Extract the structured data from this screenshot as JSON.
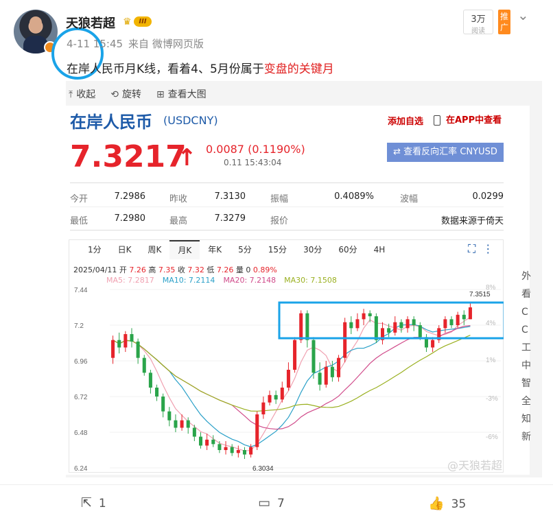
{
  "author": {
    "name": "天狼若超",
    "level_badge": "III",
    "crown_icon": "crown-icon"
  },
  "meta": {
    "date": "4-11 15:45",
    "source": "来自 微博网页版"
  },
  "views": {
    "count": "3万",
    "label": "阅读"
  },
  "promote": "推广",
  "post": {
    "text_pre": "在岸人民币月K线，看着4、5月份属于",
    "text_red": "变盘的关键月"
  },
  "toolbar": {
    "collapse": "收起",
    "rotate": "旋转",
    "view_large": "查看大图"
  },
  "quote": {
    "title": "在岸人民币",
    "code": "(USDCNY)",
    "add_fav": "添加自选",
    "in_app": "在APP中查看",
    "price": "7.3217",
    "change": "0.0087 (0.1190%)",
    "time": "0.11 15:43:04",
    "reverse_btn": "⇄ 查看反向汇率 CNYUSD",
    "stats_row1": [
      [
        "今开",
        "7.2986"
      ],
      [
        "昨收",
        "7.3130"
      ],
      [
        "振幅",
        "0.4089%"
      ],
      [
        "波幅",
        "0.0299"
      ]
    ],
    "stats_row2": [
      [
        "最低",
        "7.2980"
      ],
      [
        "最高",
        "7.3279"
      ],
      [
        "报价",
        ""
      ],
      [
        "",
        "数据来源于倚天"
      ]
    ]
  },
  "tabs": [
    "1分",
    "日K",
    "周K",
    "月K",
    "年K",
    "5分",
    "15分",
    "30分",
    "60分",
    "4H"
  ],
  "active_tab": "月K",
  "ohlc": {
    "date": "2025/04/11",
    "open_l": "开",
    "open": "7.26",
    "high_l": "高",
    "high": "7.35",
    "close_l": "收",
    "close": "7.32",
    "low_l": "低",
    "low": "7.26",
    "vol_l": "量",
    "vol": "0",
    "pct": "0.89%"
  },
  "ma": [
    {
      "label": "MA5: 7.2817",
      "color": "#f0a0b0"
    },
    {
      "label": "MA10: 7.2114",
      "color": "#2aa0c8"
    },
    {
      "label": "MA20: 7.2148",
      "color": "#d04a8a"
    },
    {
      "label": "MA30: 7.1508",
      "color": "#9ab020"
    }
  ],
  "chart_data": {
    "type": "candlestick",
    "y_ticks": [
      "7.44",
      "7.2",
      "6.96",
      "6.72",
      "6.48",
      "6.24"
    ],
    "ylim": [
      6.24,
      7.44
    ],
    "right_ticks": [
      "8%",
      "4%",
      "1%",
      "-3%",
      "-6%"
    ],
    "annotations": {
      "high": "7.3515",
      "low": "6.3034"
    },
    "candles": [
      [
        6.98,
        7.1,
        7.13,
        6.94
      ],
      [
        7.1,
        7.05,
        7.15,
        7.01
      ],
      [
        7.05,
        7.14,
        7.16,
        7.02
      ],
      [
        7.14,
        7.09,
        7.18,
        7.05
      ],
      [
        7.09,
        6.98,
        7.11,
        6.94
      ],
      [
        6.98,
        6.88,
        7.0,
        6.86
      ],
      [
        6.88,
        6.78,
        6.9,
        6.74
      ],
      [
        6.78,
        6.72,
        6.8,
        6.69
      ],
      [
        6.72,
        6.62,
        6.74,
        6.58
      ],
      [
        6.62,
        6.56,
        6.65,
        6.52
      ],
      [
        6.56,
        6.51,
        6.6,
        6.48
      ],
      [
        6.51,
        6.56,
        6.6,
        6.49
      ],
      [
        6.56,
        6.51,
        6.58,
        6.47
      ],
      [
        6.51,
        6.45,
        6.53,
        6.42
      ],
      [
        6.45,
        6.39,
        6.48,
        6.37
      ],
      [
        6.39,
        6.43,
        6.47,
        6.36
      ],
      [
        6.43,
        6.4,
        6.46,
        6.38
      ],
      [
        6.4,
        6.36,
        6.42,
        6.34
      ],
      [
        6.36,
        6.38,
        6.42,
        6.33
      ],
      [
        6.38,
        6.34,
        6.4,
        6.32
      ],
      [
        6.34,
        6.36,
        6.39,
        6.31
      ],
      [
        6.36,
        6.33,
        6.38,
        6.3
      ],
      [
        6.33,
        6.38,
        6.4,
        6.31
      ],
      [
        6.38,
        6.6,
        6.62,
        6.36
      ],
      [
        6.6,
        6.68,
        6.72,
        6.57
      ],
      [
        6.68,
        6.73,
        6.76,
        6.66
      ],
      [
        6.73,
        6.7,
        6.76,
        6.67
      ],
      [
        6.7,
        6.78,
        6.82,
        6.68
      ],
      [
        6.78,
        6.9,
        6.95,
        6.76
      ],
      [
        6.9,
        7.1,
        7.12,
        6.88
      ],
      [
        7.1,
        7.28,
        7.3,
        7.08
      ],
      [
        7.28,
        7.1,
        7.3,
        7.05
      ],
      [
        7.1,
        6.88,
        7.12,
        6.84
      ],
      [
        6.88,
        6.8,
        6.95,
        6.76
      ],
      [
        6.8,
        6.92,
        6.96,
        6.78
      ],
      [
        6.92,
        6.85,
        6.96,
        6.82
      ],
      [
        6.85,
        6.98,
        7.0,
        6.82
      ],
      [
        6.98,
        7.22,
        7.25,
        6.95
      ],
      [
        7.22,
        7.18,
        7.26,
        7.14
      ],
      [
        7.18,
        7.24,
        7.28,
        7.16
      ],
      [
        7.24,
        7.28,
        7.31,
        7.2
      ],
      [
        7.28,
        7.26,
        7.3,
        7.22
      ],
      [
        7.26,
        7.1,
        7.28,
        7.08
      ],
      [
        7.1,
        7.18,
        7.22,
        7.07
      ],
      [
        7.18,
        7.15,
        7.21,
        7.12
      ],
      [
        7.15,
        7.22,
        7.26,
        7.13
      ],
      [
        7.22,
        7.18,
        7.24,
        7.15
      ],
      [
        7.18,
        7.24,
        7.26,
        7.15
      ],
      [
        7.24,
        7.2,
        7.26,
        7.16
      ],
      [
        7.2,
        7.12,
        7.22,
        7.1
      ],
      [
        7.12,
        7.05,
        7.14,
        7.02
      ],
      [
        7.05,
        7.1,
        7.12,
        7.02
      ],
      [
        7.1,
        7.18,
        7.2,
        7.08
      ],
      [
        7.18,
        7.24,
        7.26,
        7.15
      ],
      [
        7.24,
        7.2,
        7.26,
        7.18
      ],
      [
        7.2,
        7.27,
        7.29,
        7.18
      ],
      [
        7.27,
        7.24,
        7.3,
        7.2
      ],
      [
        7.24,
        7.32,
        7.35,
        7.24
      ]
    ]
  },
  "highlight_color": "#1aa3e8",
  "watermark": "@天狼若超",
  "sidebar_chars": [
    "外",
    "看",
    "C",
    "C",
    "工",
    "中",
    "智",
    "全",
    "知",
    "新"
  ],
  "footer": {
    "share": "1",
    "comment": "7",
    "like": "35"
  }
}
